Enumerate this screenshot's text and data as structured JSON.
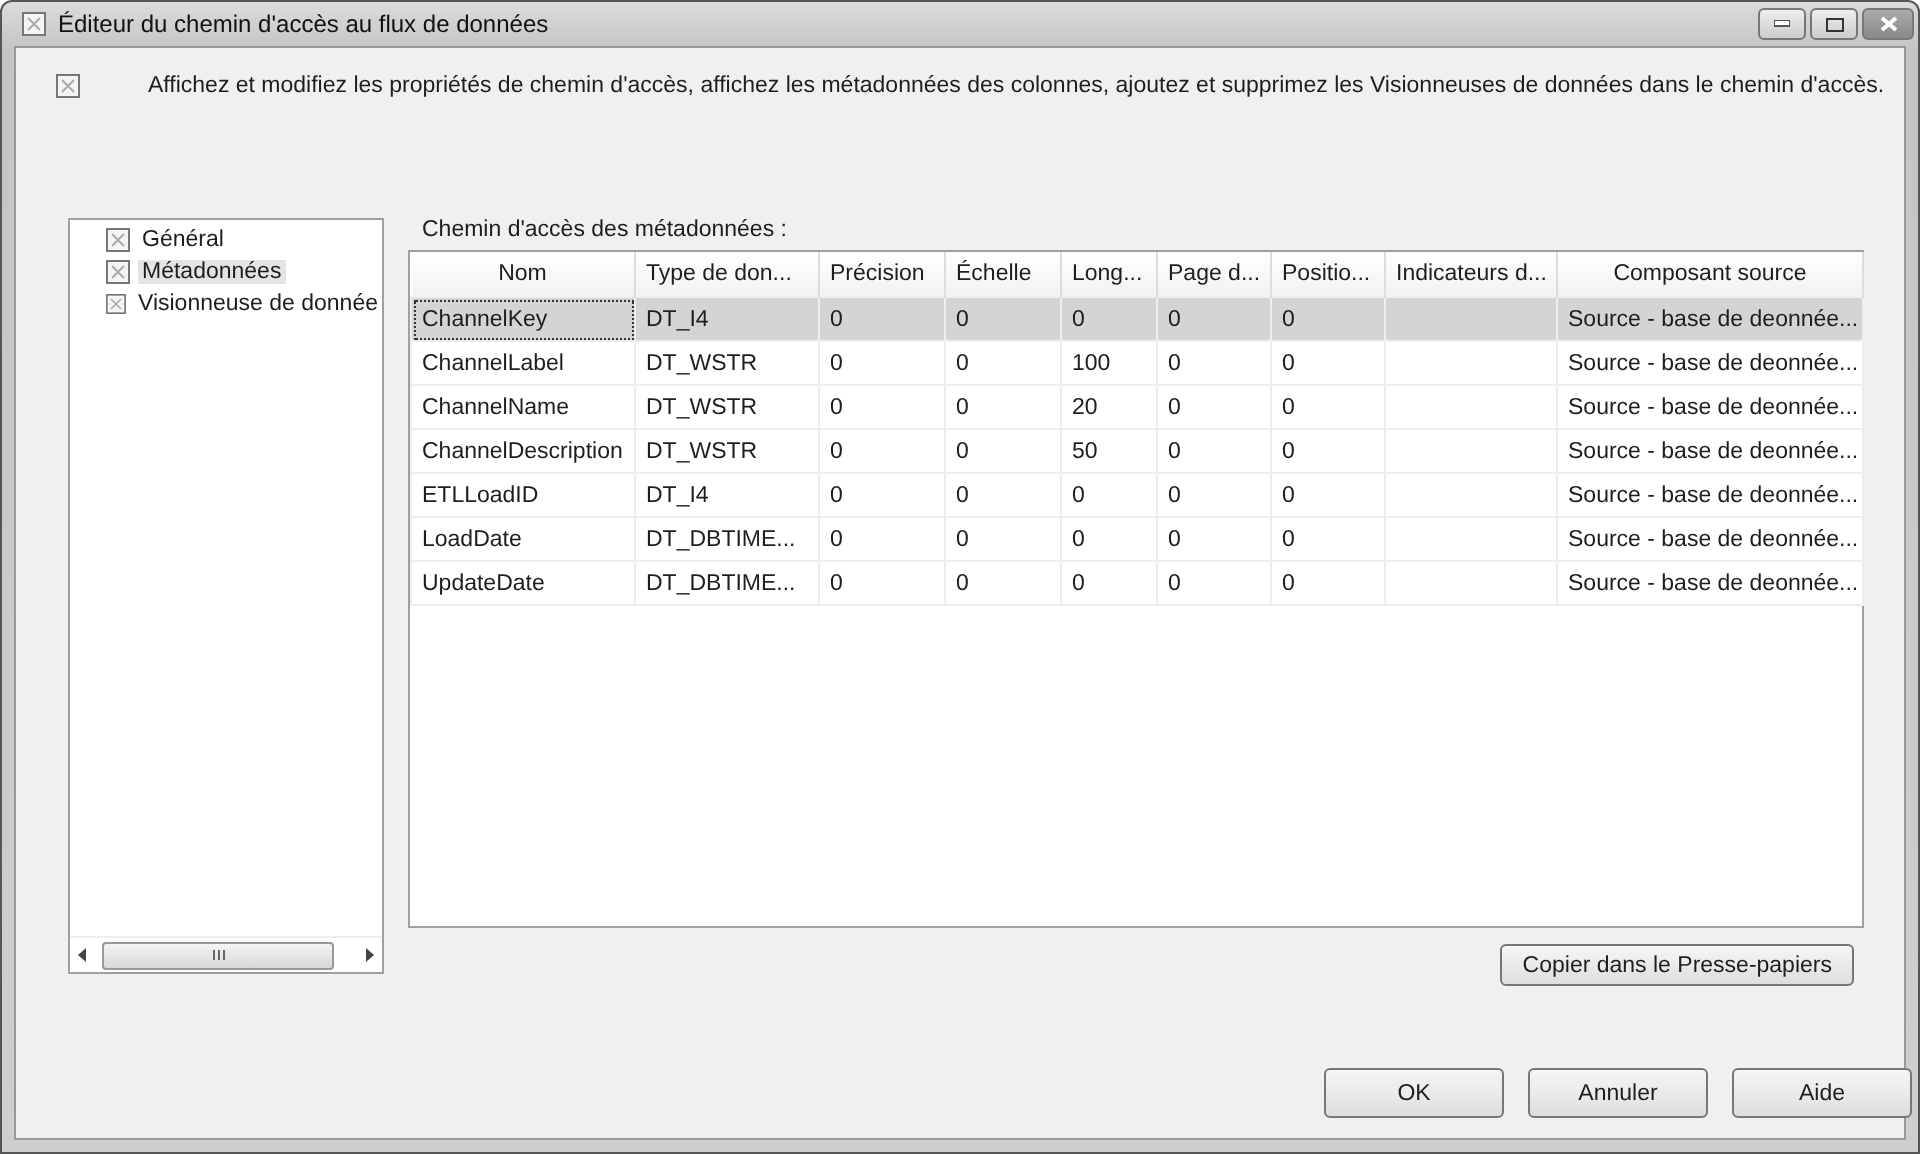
{
  "window": {
    "title": "Éditeur du chemin d'accès au flux de données"
  },
  "description": "Affichez et modifiez les propriétés de chemin d'accès, affichez les métadonnées des colonnes, ajoutez et supprimez les Visionneuses de données dans le chemin d'accès.",
  "nav": [
    {
      "label": "Général",
      "selected": false
    },
    {
      "label": "Métadonnées",
      "selected": true
    },
    {
      "label": "Visionneuse de donnée",
      "selected": false
    }
  ],
  "grid_label": "Chemin d'accès des métadonnées :",
  "table": {
    "columns": [
      "Nom",
      "Type de don...",
      "Précision",
      "Échelle",
      "Long...",
      "Page d...",
      "Positio...",
      "Indicateurs d...",
      "Composant source"
    ],
    "rows": [
      {
        "selected": true,
        "cells": [
          "ChannelKey",
          "DT_I4",
          "0",
          "0",
          "0",
          "0",
          "0",
          "",
          "Source - base de deonnée..."
        ]
      },
      {
        "selected": false,
        "cells": [
          "ChannelLabel",
          "DT_WSTR",
          "0",
          "0",
          "100",
          "0",
          "0",
          "",
          "Source - base de deonnée..."
        ]
      },
      {
        "selected": false,
        "cells": [
          "ChannelName",
          "DT_WSTR",
          "0",
          "0",
          "20",
          "0",
          "0",
          "",
          "Source - base de deonnée..."
        ]
      },
      {
        "selected": false,
        "cells": [
          "ChannelDescription",
          "DT_WSTR",
          "0",
          "0",
          "50",
          "0",
          "0",
          "",
          "Source - base de deonnée..."
        ]
      },
      {
        "selected": false,
        "cells": [
          "ETLLoadID",
          "DT_I4",
          "0",
          "0",
          "0",
          "0",
          "0",
          "",
          "Source - base de deonnée..."
        ]
      },
      {
        "selected": false,
        "cells": [
          "LoadDate",
          "DT_DBTIME...",
          "0",
          "0",
          "0",
          "0",
          "0",
          "",
          "Source - base de deonnée..."
        ]
      },
      {
        "selected": false,
        "cells": [
          "UpdateDate",
          "DT_DBTIME...",
          "0",
          "0",
          "0",
          "0",
          "0",
          "",
          "Source - base de deonnée..."
        ]
      }
    ]
  },
  "copy_button": "Copier dans le Presse-papiers",
  "buttons": [
    "OK",
    "Annuler",
    "Aide"
  ]
}
